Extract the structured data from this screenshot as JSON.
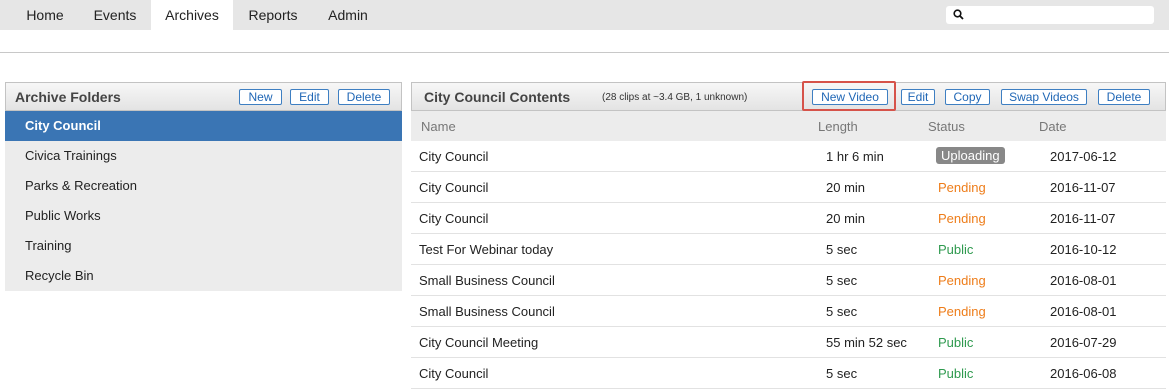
{
  "nav": {
    "tabs": [
      {
        "label": "Home"
      },
      {
        "label": "Events"
      },
      {
        "label": "Archives",
        "active": true
      },
      {
        "label": "Reports"
      },
      {
        "label": "Admin"
      }
    ],
    "search": {
      "value": "",
      "placeholder": ""
    }
  },
  "folders_panel": {
    "title": "Archive Folders",
    "buttons": {
      "new": "New",
      "edit": "Edit",
      "delete": "Delete"
    },
    "items": [
      {
        "label": "City Council",
        "selected": true
      },
      {
        "label": "Civica Trainings"
      },
      {
        "label": "Parks & Recreation"
      },
      {
        "label": "Public Works"
      },
      {
        "label": "Training"
      },
      {
        "label": "Recycle Bin"
      }
    ]
  },
  "contents_panel": {
    "title": "City Council Contents",
    "subtitle": "(28 clips at ~3.4 GB, 1 unknown)",
    "buttons": {
      "new_video": "New Video",
      "edit": "Edit",
      "copy": "Copy",
      "swap_videos": "Swap Videos",
      "delete": "Delete"
    },
    "columns": {
      "name": "Name",
      "length": "Length",
      "status": "Status",
      "date": "Date"
    },
    "rows": [
      {
        "name": "City Council",
        "length": "1 hr 6 min",
        "status": "Uploading",
        "date": "2017-06-12"
      },
      {
        "name": "City Council",
        "length": "20 min",
        "status": "Pending",
        "date": "2016-11-07"
      },
      {
        "name": "City Council",
        "length": "20 min",
        "status": "Pending",
        "date": "2016-11-07"
      },
      {
        "name": "Test For Webinar today",
        "length": "5 sec",
        "status": "Public",
        "date": "2016-10-12"
      },
      {
        "name": "Small Business Council",
        "length": "5 sec",
        "status": "Pending",
        "date": "2016-08-01"
      },
      {
        "name": "Small Business Council",
        "length": "5 sec",
        "status": "Pending",
        "date": "2016-08-01"
      },
      {
        "name": "City Council Meeting",
        "length": "55 min 52 sec",
        "status": "Public",
        "date": "2016-07-29"
      },
      {
        "name": "City Council",
        "length": "5 sec",
        "status": "Public",
        "date": "2016-06-08"
      }
    ]
  },
  "colors": {
    "accent": "#3a75b4",
    "pending": "#ee7d1a",
    "public": "#2f9a4f",
    "uploading_bg": "#888888",
    "highlight": "#d6534a"
  }
}
